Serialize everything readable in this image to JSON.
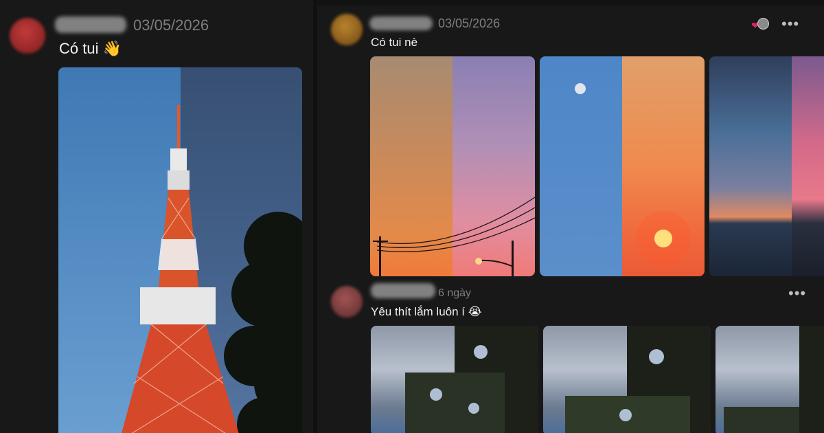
{
  "left_post": {
    "date": "03/05/2026",
    "caption": "Có tui 👋"
  },
  "right_post_1": {
    "date": "03/05/2026",
    "caption": "Có tui nè",
    "more_label": "•••",
    "reaction_icons": [
      "heart-icon",
      "avatar-reaction-icon"
    ]
  },
  "right_post_2": {
    "date": "6 ngày",
    "caption": "Yêu thít lắm luôn í 😭",
    "more_label": "•••"
  },
  "colors": {
    "background": "#181818",
    "text": "#f2f2f2",
    "muted": "#7f7f7f",
    "heart": "#e0245e"
  }
}
